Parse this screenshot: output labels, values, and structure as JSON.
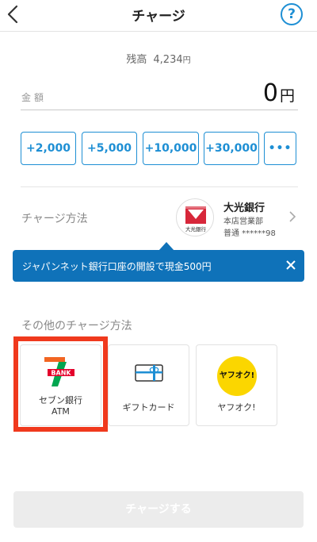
{
  "header": {
    "title": "チャージ",
    "help_label": "?"
  },
  "balance": {
    "label": "残高",
    "value": "4,234",
    "unit": "円"
  },
  "amount": {
    "label": "金額",
    "value": "0",
    "unit": "円"
  },
  "quick_amounts": [
    "+2,000",
    "+5,000",
    "+10,000",
    "+30,000",
    "•••"
  ],
  "charge_method": {
    "label": "チャージ方法",
    "bank_name": "大光銀行",
    "branch": "本店営業部",
    "account": "普通 ******98",
    "logo_caption": "大光銀行"
  },
  "banner": {
    "text": "ジャパンネット銀行口座の開設で現金500円"
  },
  "other_methods": {
    "label": "その他のチャージ方法",
    "items": [
      {
        "line1": "セブン銀行",
        "line2": "ATM",
        "logo_text": "BANK"
      },
      {
        "line1": "ギフトカード"
      },
      {
        "line1": "ヤフオク!",
        "logo_text": "ヤフオク!"
      }
    ]
  },
  "submit": {
    "label": "チャージする"
  },
  "colors": {
    "accent": "#1e8fd4",
    "banner": "#0f72b9",
    "highlight": "#f0391d",
    "disabled_button": "#ececec"
  }
}
